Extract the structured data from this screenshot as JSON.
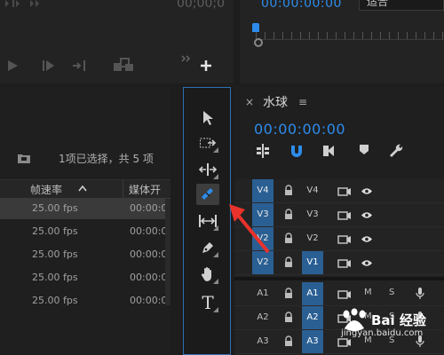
{
  "source_monitor": {
    "timecode": "00;00;0",
    "controls": [
      "play-icon",
      "step-forward-icon",
      "insert-icon",
      "overwrite-icon",
      "expand-icon",
      "add-icon"
    ]
  },
  "program_monitor": {
    "timecode": "00:00:00:00",
    "fit_select": "适合"
  },
  "project_panel": {
    "selection_info": "1项已选择，共 5 项",
    "columns": {
      "framerate": "帧速率",
      "media_start": "媒体开"
    },
    "rows": [
      {
        "fps": "25.00 fps",
        "media": "00:00:0",
        "selected": true
      },
      {
        "fps": "25.00 fps",
        "media": "00:00:0",
        "selected": false
      },
      {
        "fps": "25.00 fps",
        "media": "00:00:0",
        "selected": false
      },
      {
        "fps": "25.00 fps",
        "media": "00:00:0",
        "selected": false
      },
      {
        "fps": "25.00 fps",
        "media": "00:00:0",
        "selected": false
      }
    ]
  },
  "tools_panel": {
    "tools": [
      {
        "name": "selection-tool",
        "icon": "arrow-cursor-icon"
      },
      {
        "name": "track-select-tool",
        "icon": "track-select-icon"
      },
      {
        "name": "ripple-edit-tool",
        "icon": "ripple-edit-icon"
      },
      {
        "name": "razor-tool",
        "icon": "razor-icon",
        "active": true
      },
      {
        "name": "slip-tool",
        "icon": "slip-icon"
      },
      {
        "name": "pen-tool",
        "icon": "pen-icon"
      },
      {
        "name": "hand-tool",
        "icon": "hand-icon"
      },
      {
        "name": "type-tool",
        "icon": "type-icon",
        "glyph": "T"
      }
    ]
  },
  "timeline": {
    "title": "水球",
    "close_glyph": "×",
    "menu_glyph": "≡",
    "timecode": "00:00:00:00",
    "video_tracks": [
      {
        "source": "V4",
        "target": "V4",
        "source_active": true,
        "target_active": false
      },
      {
        "source": "V3",
        "target": "V3",
        "source_active": true,
        "target_active": false
      },
      {
        "source": "V2",
        "target": "V2",
        "source_active": true,
        "target_active": false
      },
      {
        "source": "V2",
        "target": "V1",
        "source_active": true,
        "target_active": true
      }
    ],
    "audio_tracks": [
      {
        "source": "A1",
        "target": "A1",
        "mute": "M",
        "solo": "S"
      },
      {
        "source": "A2",
        "target": "A2",
        "mute": "M",
        "solo": "S"
      },
      {
        "source": "A3",
        "target": "A3",
        "mute": "M",
        "solo": "S"
      }
    ]
  },
  "watermark": {
    "text": "Bai 经验",
    "url": "jingyan.baidu.com"
  },
  "colors": {
    "accent_blue": "#2d8ceb",
    "track_blue": "#2a5f93",
    "annotation_red": "#e8322b"
  }
}
